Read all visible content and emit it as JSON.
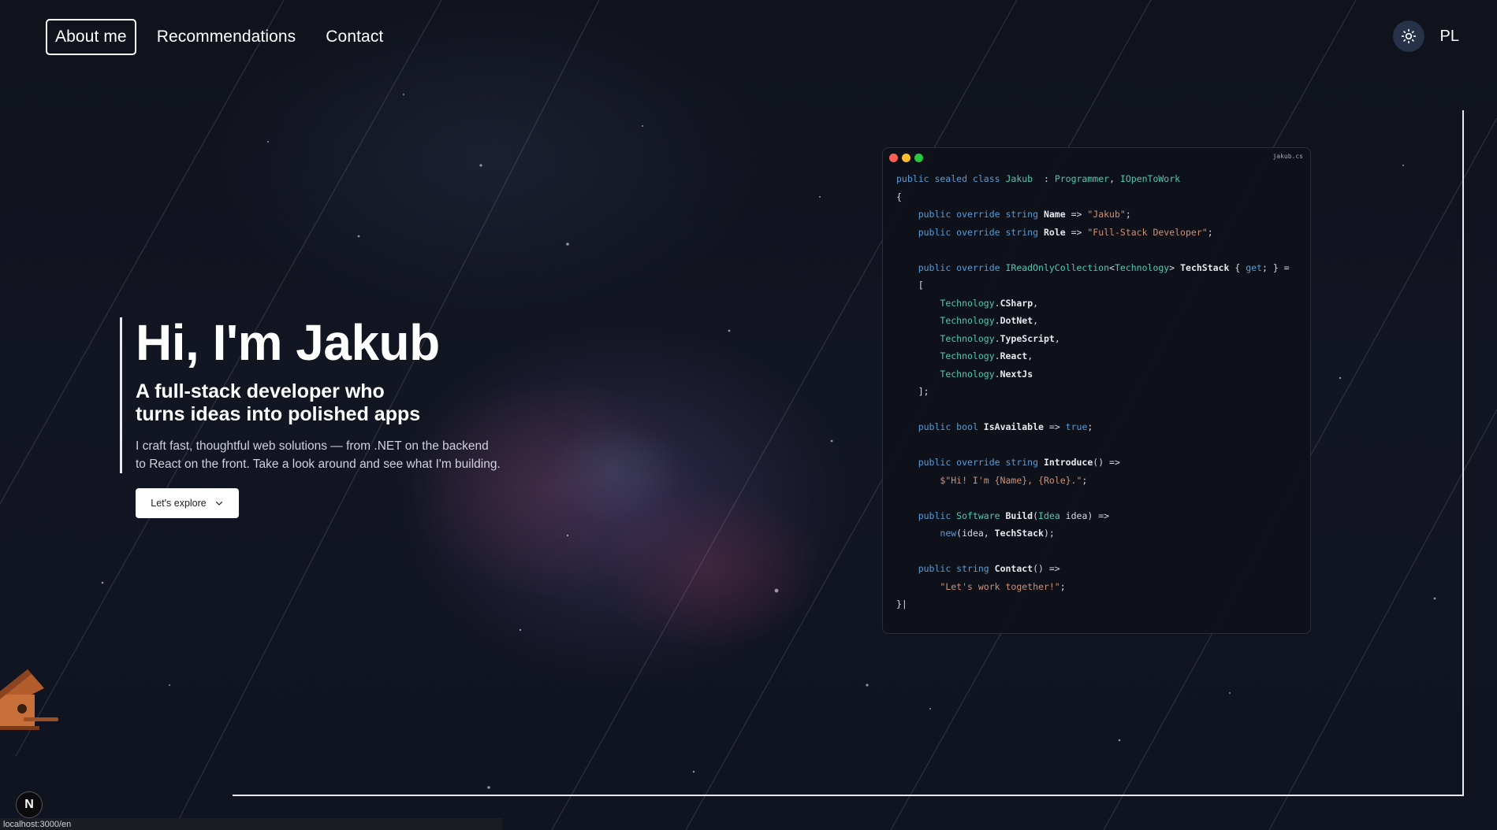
{
  "nav": {
    "items": [
      {
        "label": "About me",
        "active": true
      },
      {
        "label": "Recommendations",
        "active": false
      },
      {
        "label": "Contact",
        "active": false
      }
    ],
    "theme_icon": "sun-icon",
    "language": "PL"
  },
  "hero": {
    "title": "Hi, I'm Jakub",
    "subtitle_line1": "A full-stack developer who",
    "subtitle_line2": "turns ideas into polished apps",
    "desc_line1": "I craft fast, thoughtful web solutions — from .NET on the backend",
    "desc_line2": "to React on the front. Take a look around and see what I'm building.",
    "cta_label": "Let's explore"
  },
  "code_window": {
    "filename": "jakub.cs",
    "dot_colors": [
      "#ff5f57",
      "#febc2e",
      "#28c840"
    ],
    "lines": [
      [
        [
          "kw",
          "public sealed class "
        ],
        [
          "ty",
          "Jakub"
        ],
        [
          "",
          "  : "
        ],
        [
          "ty",
          "Programmer"
        ],
        [
          "",
          ", "
        ],
        [
          "ty",
          "IOpenToWork"
        ]
      ],
      [
        [
          "",
          "{"
        ]
      ],
      [
        [
          "",
          "    "
        ],
        [
          "kw",
          "public override string "
        ],
        [
          "pr",
          "Name"
        ],
        [
          "",
          " => "
        ],
        [
          "st",
          "\"Jakub\""
        ],
        [
          "",
          ";"
        ]
      ],
      [
        [
          "",
          "    "
        ],
        [
          "kw",
          "public override string "
        ],
        [
          "pr",
          "Role"
        ],
        [
          "",
          " => "
        ],
        [
          "st",
          "\"Full-Stack Developer\""
        ],
        [
          "",
          ";"
        ]
      ],
      [],
      [
        [
          "",
          "    "
        ],
        [
          "kw",
          "public override "
        ],
        [
          "ty",
          "IReadOnlyCollection"
        ],
        [
          "",
          "<"
        ],
        [
          "ty",
          "Technology"
        ],
        [
          "",
          "> "
        ],
        [
          "pr",
          "TechStack"
        ],
        [
          "",
          " { "
        ],
        [
          "kw",
          "get"
        ],
        [
          "",
          "; } ="
        ]
      ],
      [
        [
          "",
          "    ["
        ]
      ],
      [
        [
          "",
          "        "
        ],
        [
          "ty",
          "Technology"
        ],
        [
          "",
          "."
        ],
        [
          "pr",
          "CSharp"
        ],
        [
          "",
          ","
        ]
      ],
      [
        [
          "",
          "        "
        ],
        [
          "ty",
          "Technology"
        ],
        [
          "",
          "."
        ],
        [
          "pr",
          "DotNet"
        ],
        [
          "",
          ","
        ]
      ],
      [
        [
          "",
          "        "
        ],
        [
          "ty",
          "Technology"
        ],
        [
          "",
          "."
        ],
        [
          "pr",
          "TypeScript"
        ],
        [
          "",
          ","
        ]
      ],
      [
        [
          "",
          "        "
        ],
        [
          "ty",
          "Technology"
        ],
        [
          "",
          "."
        ],
        [
          "pr",
          "React"
        ],
        [
          "",
          ","
        ]
      ],
      [
        [
          "",
          "        "
        ],
        [
          "ty",
          "Technology"
        ],
        [
          "",
          "."
        ],
        [
          "pr",
          "NextJs"
        ]
      ],
      [
        [
          "",
          "    ];"
        ]
      ],
      [],
      [
        [
          "",
          "    "
        ],
        [
          "kw",
          "public bool "
        ],
        [
          "pr",
          "IsAvailable"
        ],
        [
          "",
          " => "
        ],
        [
          "kw",
          "true"
        ],
        [
          "",
          ";"
        ]
      ],
      [],
      [
        [
          "",
          "    "
        ],
        [
          "kw",
          "public override string "
        ],
        [
          "pr",
          "Introduce"
        ],
        [
          "",
          "() =>"
        ]
      ],
      [
        [
          "",
          "        "
        ],
        [
          "st",
          "$\"Hi! I'm {Name}, {Role}.\""
        ],
        [
          "",
          ";"
        ]
      ],
      [],
      [
        [
          "",
          "    "
        ],
        [
          "kw",
          "public "
        ],
        [
          "ty",
          "Software "
        ],
        [
          "pr",
          "Build"
        ],
        [
          "",
          "("
        ],
        [
          "ty",
          "Idea"
        ],
        [
          "",
          " idea) =>"
        ]
      ],
      [
        [
          "",
          "        "
        ],
        [
          "kw",
          "new"
        ],
        [
          "",
          "(idea, "
        ],
        [
          "pr",
          "TechStack"
        ],
        [
          "",
          ");"
        ]
      ],
      [],
      [
        [
          "",
          "    "
        ],
        [
          "kw",
          "public string "
        ],
        [
          "pr",
          "Contact"
        ],
        [
          "",
          "() =>"
        ]
      ],
      [
        [
          "",
          "        "
        ],
        [
          "st",
          "\"Let's work together!\""
        ],
        [
          "",
          ";"
        ]
      ],
      [
        [
          "",
          "}|"
        ]
      ]
    ]
  },
  "n_badge": "N",
  "status_url": "localhost:3000/en",
  "decor": {
    "birdhouse_icon": "birdhouse-icon",
    "accent": "#e8e8ee"
  }
}
